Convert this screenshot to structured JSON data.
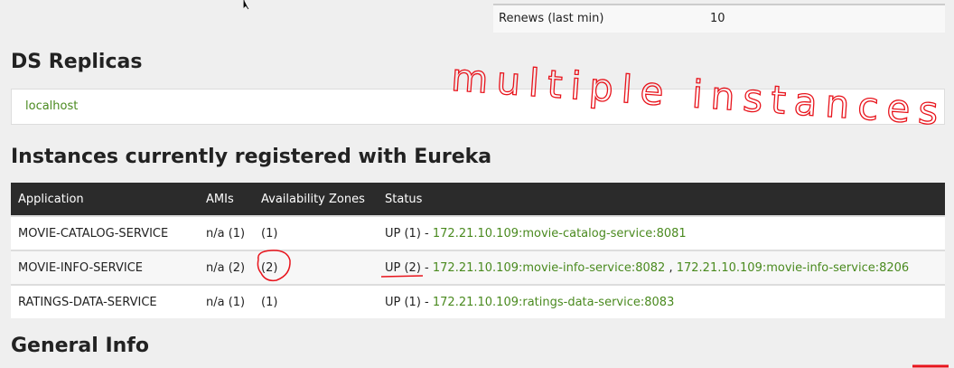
{
  "top_table": {
    "label": "Renews (last min)",
    "value": "10"
  },
  "ds_replicas": {
    "title": "DS Replicas",
    "items": [
      "localhost"
    ]
  },
  "instances": {
    "title": "Instances currently registered with Eureka",
    "columns": [
      "Application",
      "AMIs",
      "Availability Zones",
      "Status"
    ],
    "rows": [
      {
        "app": "MOVIE-CATALOG-SERVICE",
        "amis": "n/a (1)",
        "zones": "(1)",
        "status": "UP (1)",
        "sep": " - ",
        "links": [
          "172.21.10.109:movie-catalog-service:8081"
        ]
      },
      {
        "app": "MOVIE-INFO-SERVICE",
        "amis": "n/a (2)",
        "zones": "(2)",
        "status": "UP (2)",
        "sep": " - ",
        "links": [
          "172.21.10.109:movie-info-service:8082",
          "172.21.10.109:movie-info-service:8206"
        ]
      },
      {
        "app": "RATINGS-DATA-SERVICE",
        "amis": "n/a (1)",
        "zones": "(1)",
        "status": "UP (1)",
        "sep": " - ",
        "links": [
          "172.21.10.109:ratings-data-service:8083"
        ]
      }
    ]
  },
  "general_info": {
    "title": "General Info"
  },
  "annotation": {
    "text": "multiple instances",
    "color": "#e8141c"
  }
}
